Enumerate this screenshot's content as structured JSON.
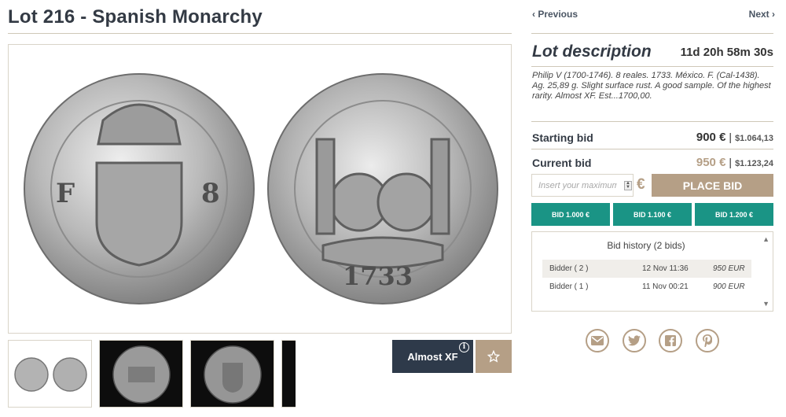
{
  "lot": {
    "title": "Lot 216 - Spanish Monarchy",
    "grade_label": "Almost XF",
    "grade_info_glyph": "i"
  },
  "nav": {
    "previous": "‹ Previous",
    "next": "Next ›"
  },
  "description": {
    "heading": "Lot description",
    "timer": "11d 20h 58m 30s",
    "text": "Philip V (1700-1746). 8 reales. 1733. México. F. (Cal-1438). Ag. 25,89 g. Slight surface rust. A good sample. Of the highest rarity. Almost XF. Est...1700,00."
  },
  "bids": {
    "starting_label": "Starting bid",
    "starting_eur": "900 €",
    "starting_usd": "$1.064,13",
    "current_label": "Current bid",
    "current_eur": "950 €",
    "current_usd": "$1.123,24",
    "separator": "|",
    "input_placeholder": "Insert your maximum bid",
    "currency_symbol": "€",
    "place_bid": "PLACE BID",
    "quick": [
      "BID 1.000 €",
      "BID 1.100 €",
      "BID 1.200 €"
    ]
  },
  "history": {
    "title": "Bid history (2 bids)",
    "rows": [
      {
        "bidder": "Bidder ( 2 )",
        "date": "12 Nov 11:36",
        "amount": "950 EUR"
      },
      {
        "bidder": "Bidder ( 1 )",
        "date": "11 Nov 00:21",
        "amount": "900 EUR"
      }
    ]
  },
  "share_icons": [
    "email-icon",
    "twitter-icon",
    "facebook-icon",
    "pinterest-icon"
  ],
  "colors": {
    "accent_gold": "#b59f86",
    "teal": "#1a9485",
    "navy": "#2e3a4a"
  }
}
